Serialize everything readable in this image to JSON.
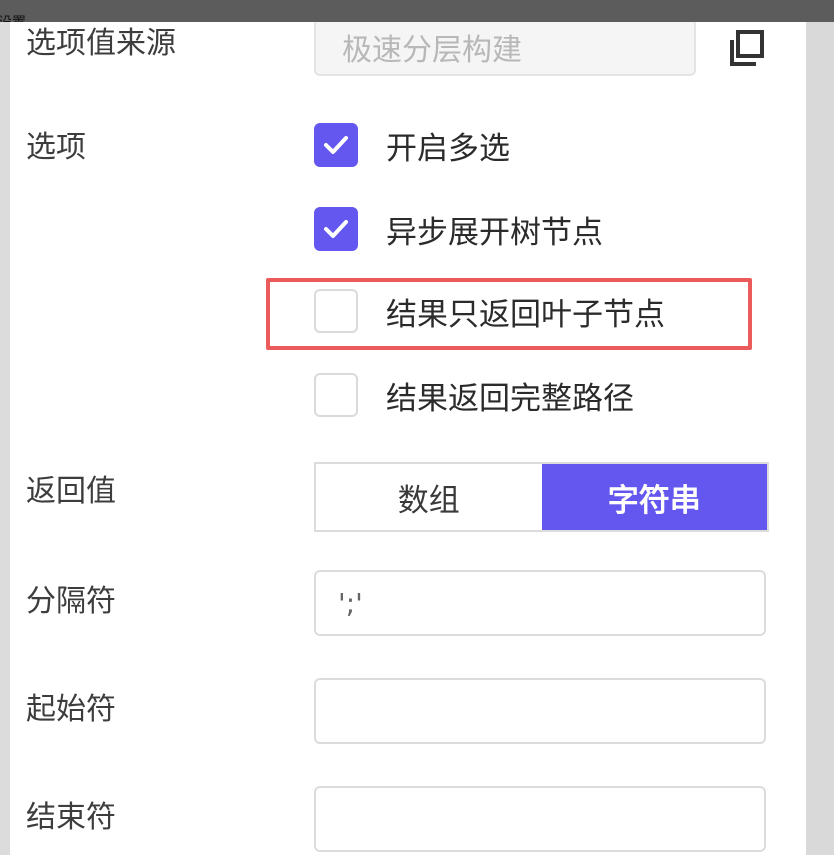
{
  "backdrop": {
    "edge_text": "设置"
  },
  "form": {
    "source": {
      "label": "选项值来源",
      "value": "极速分层构建"
    },
    "options": {
      "label": "选项",
      "items": [
        {
          "label": "开启多选",
          "checked": true
        },
        {
          "label": "异步展开树节点",
          "checked": true
        },
        {
          "label": "结果只返回叶子节点",
          "checked": false
        },
        {
          "label": "结果返回完整路径",
          "checked": false
        }
      ]
    },
    "return_value": {
      "label": "返回值",
      "segments": [
        "数组",
        "字符串"
      ],
      "selected": "字符串"
    },
    "separator": {
      "label": "分隔符",
      "value": "';'"
    },
    "start_char": {
      "label": "起始符",
      "value": ""
    },
    "end_char": {
      "label": "结束符",
      "value": ""
    }
  },
  "colors": {
    "accent": "#6457f0",
    "highlight": "#ec5b5b"
  },
  "icons": {
    "copy": "copy-icon",
    "check": "check-icon"
  }
}
